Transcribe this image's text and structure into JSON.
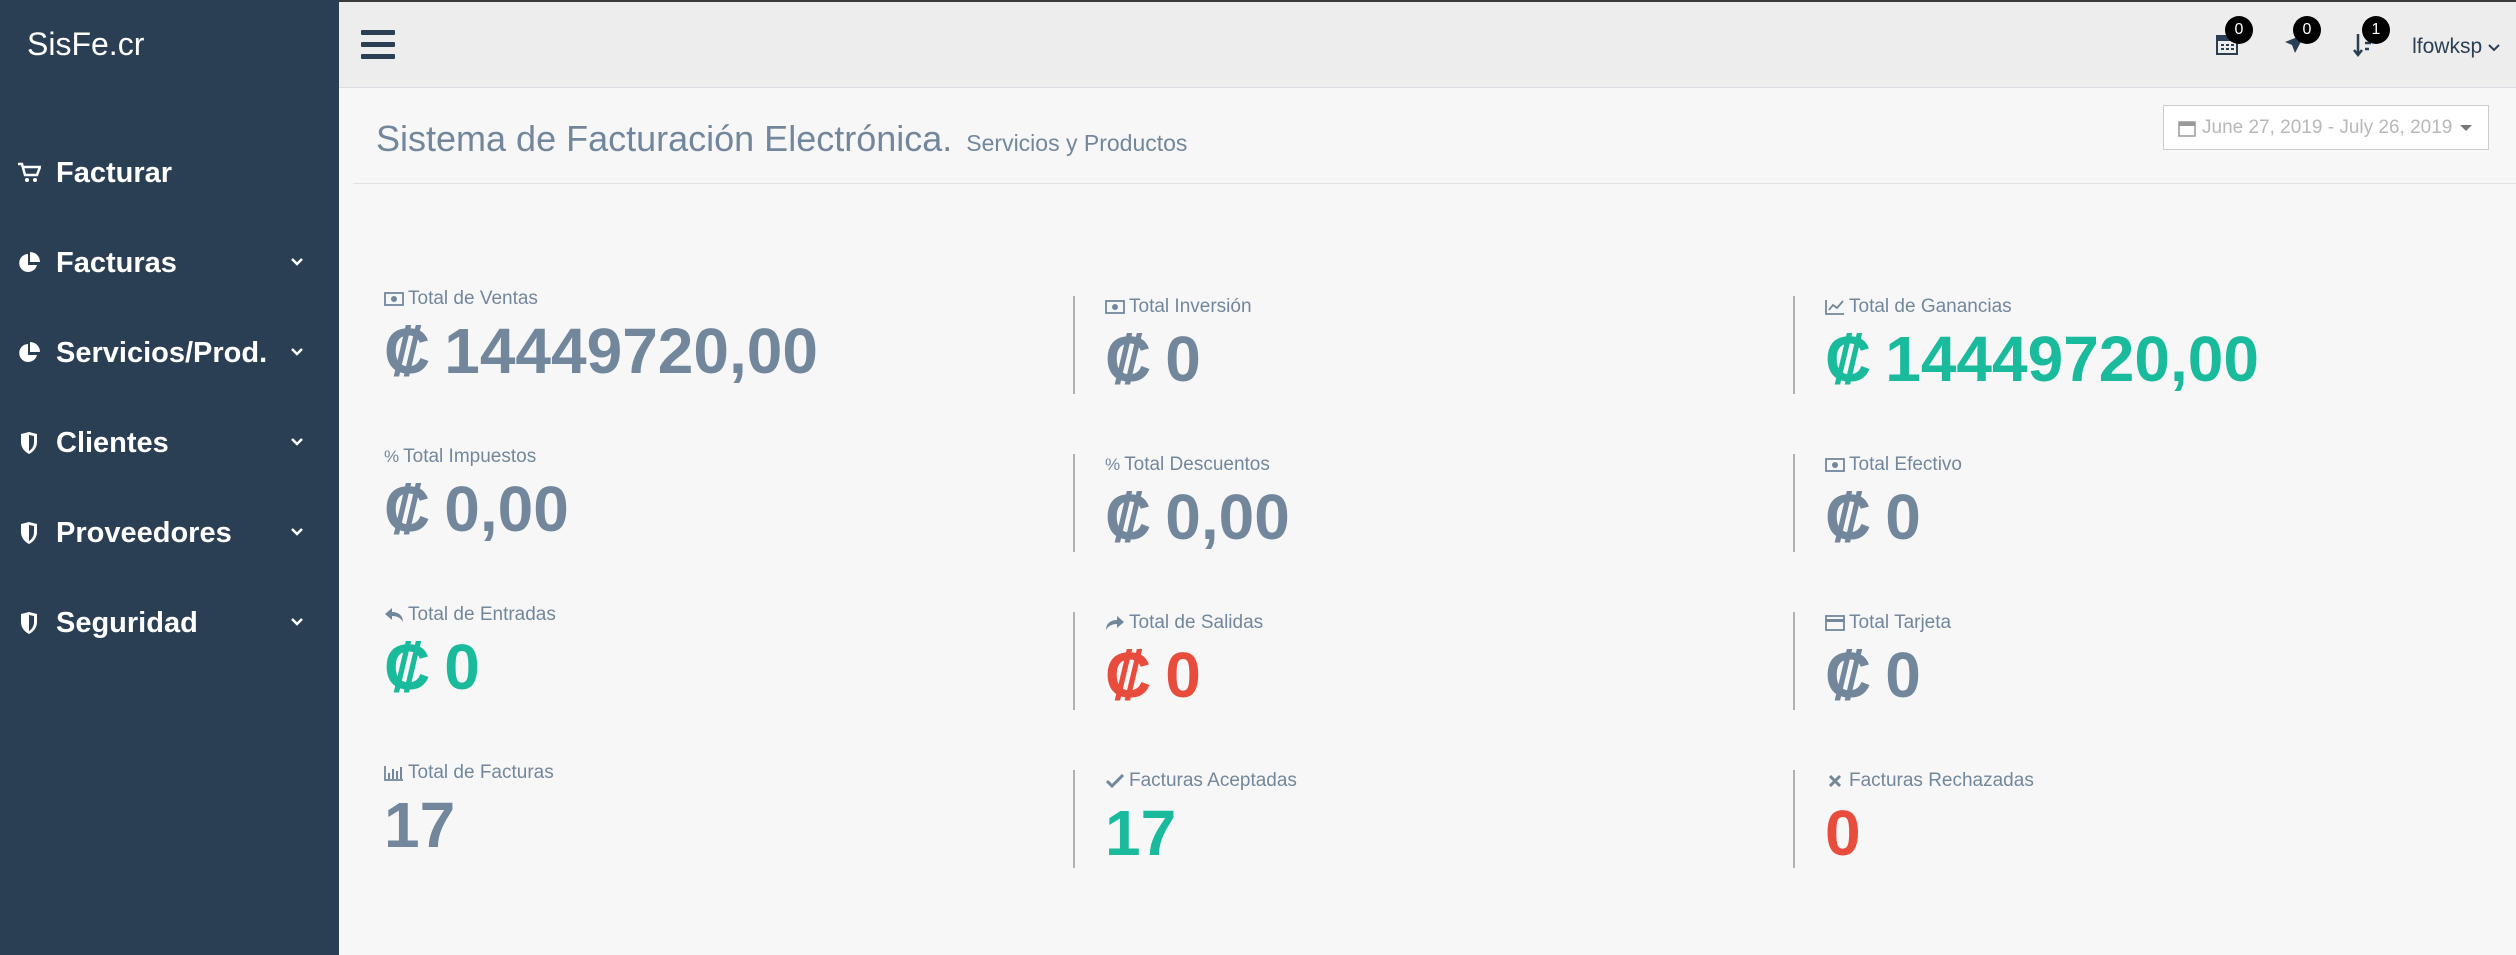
{
  "sidebar": {
    "brand": "SisFe.cr",
    "items": [
      {
        "label": "Facturar",
        "icon": "shopping-cart-icon",
        "has_submenu": false
      },
      {
        "label": "Facturas",
        "icon": "pie-chart-icon",
        "has_submenu": true
      },
      {
        "label": "Servicios/Prod.",
        "icon": "pie-chart-icon",
        "has_submenu": true
      },
      {
        "label": "Clientes",
        "icon": "shield-icon",
        "has_submenu": true
      },
      {
        "label": "Proveedores",
        "icon": "shield-icon",
        "has_submenu": true
      },
      {
        "label": "Seguridad",
        "icon": "shield-icon",
        "has_submenu": true
      }
    ]
  },
  "topbar": {
    "calendar_badge": "0",
    "messages_badge": "0",
    "sort_badge": "1",
    "username": "lfowksp"
  },
  "header": {
    "title": "Sistema de Facturación Electrónica.",
    "subtitle": "Servicios y Productos",
    "date_range": "June 27, 2019 - July 26, 2019"
  },
  "currency_symbol": "₡",
  "stats": {
    "total_ventas": {
      "label": "Total de Ventas",
      "value": "14449720,00"
    },
    "total_inversion": {
      "label": "Total Inversión",
      "value": "0"
    },
    "total_ganancias": {
      "label": "Total de Ganancias",
      "value": "14449720,00"
    },
    "total_impuestos": {
      "label": "Total Impuestos",
      "value": "0,00"
    },
    "total_descuentos": {
      "label": "Total Descuentos",
      "value": "0,00"
    },
    "total_efectivo": {
      "label": "Total Efectivo",
      "value": "0"
    },
    "total_entradas": {
      "label": "Total de Entradas",
      "value": "0"
    },
    "total_salidas": {
      "label": "Total de Salidas",
      "value": "0"
    },
    "total_tarjeta": {
      "label": "Total Tarjeta",
      "value": "0"
    },
    "total_facturas": {
      "label": "Total de Facturas",
      "value": "17"
    },
    "facturas_aceptadas": {
      "label": "Facturas Aceptadas",
      "value": "17"
    },
    "facturas_rechazadas": {
      "label": "Facturas Rechazadas",
      "value": "0"
    }
  },
  "colors": {
    "sidebar_bg": "#2a3f54",
    "muted": "#73879c",
    "green": "#1abb9c",
    "red": "#e74c3c"
  }
}
